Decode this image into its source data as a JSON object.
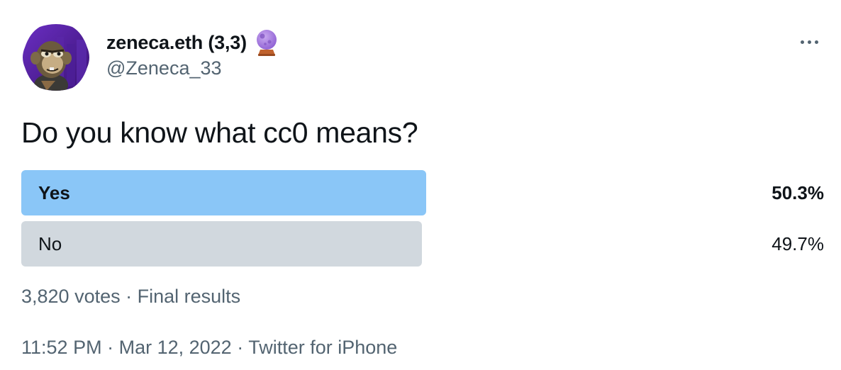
{
  "author": {
    "display_name": "zeneca.eth (3,3)",
    "handle": "@Zeneca_33",
    "emoji_icon": "crystal-ball-icon"
  },
  "tweet": {
    "text": "Do you know what cc0 means?"
  },
  "poll": {
    "options": [
      {
        "label": "Yes",
        "percent_text": "50.3%",
        "percent": 50.3,
        "winner": true
      },
      {
        "label": "No",
        "percent_text": "49.7%",
        "percent": 49.7,
        "winner": false
      }
    ],
    "votes": "3,820 votes",
    "separator": " · ",
    "status": "Final results"
  },
  "meta": {
    "time": "11:52 PM",
    "date": "Mar 12, 2022",
    "source": "Twitter for iPhone",
    "separator": " · "
  },
  "colors": {
    "winner_bar": "#8ac6f7",
    "other_bar": "#d1d8de",
    "secondary_text": "#536471",
    "avatar_bg": "#4b1f92"
  }
}
